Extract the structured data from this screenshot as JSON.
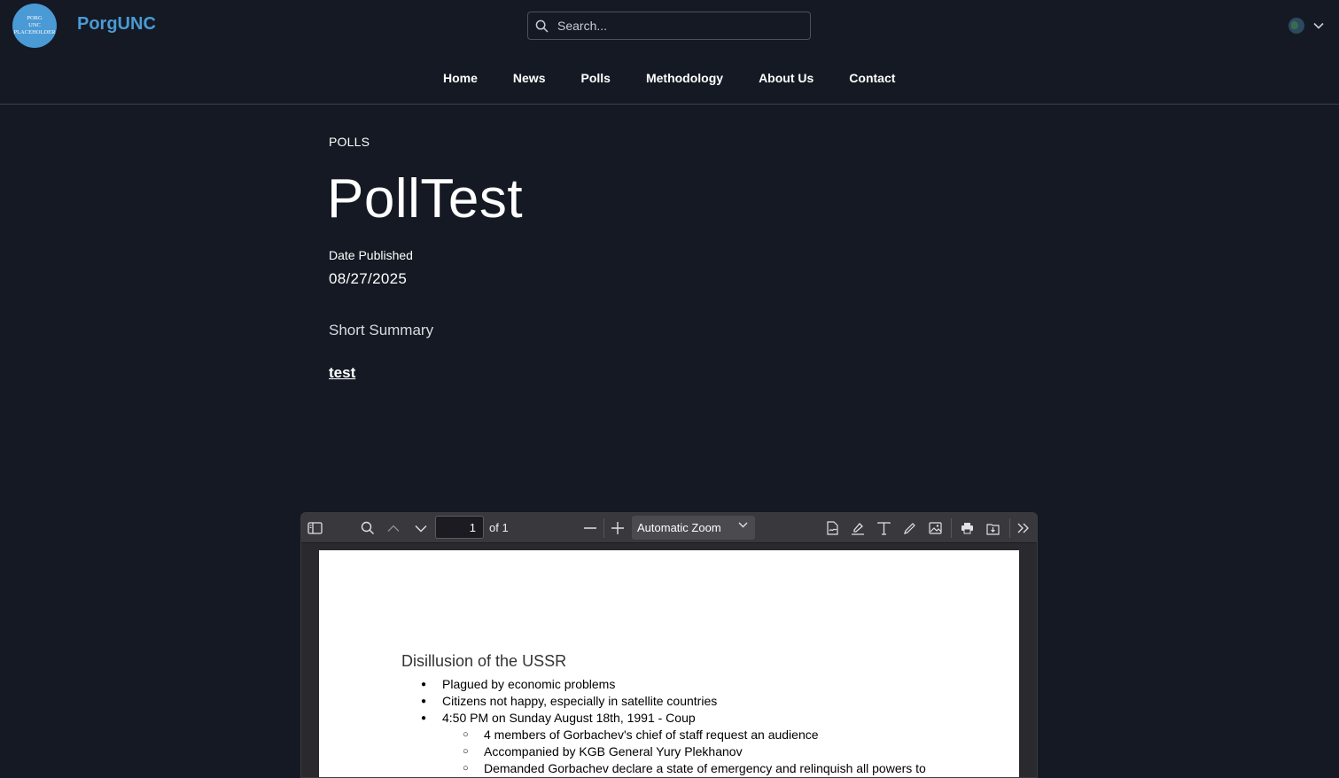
{
  "header": {
    "logo_lines": [
      "PORG",
      "UNC",
      "PLACEHOLDER"
    ],
    "brand": "PorgUNC",
    "search_placeholder": "Search...",
    "language_icon": "globe-icon"
  },
  "nav": {
    "items": [
      "Home",
      "News",
      "Polls",
      "Methodology",
      "About Us",
      "Contact"
    ]
  },
  "article": {
    "category": "POLLS",
    "title": "PollTest",
    "date_label": "Date Published",
    "date_value": "08/27/2025",
    "summary_label": "Short Summary",
    "summary_link": "test"
  },
  "pdf_viewer": {
    "page_number": "1",
    "page_count_label": "of 1",
    "zoom_label": "Automatic Zoom",
    "document": {
      "heading": "Disillusion of the USSR",
      "bullets": [
        "Plagued by economic problems",
        "Citizens not happy, especially in satellite countries",
        "4:50 PM on Sunday August 18th, 1991 - Coup"
      ],
      "sub_bullets": [
        "4 members of Gorbachev's chief of staff request an audience",
        "Accompanied by KGB General Yury Plekhanov",
        "Demanded Gorbachev declare a state of emergency and relinquish all powers to"
      ]
    }
  },
  "colors": {
    "background": "#141923",
    "accent": "#4a9ad6",
    "viewer_toolbar": "#38383d"
  }
}
